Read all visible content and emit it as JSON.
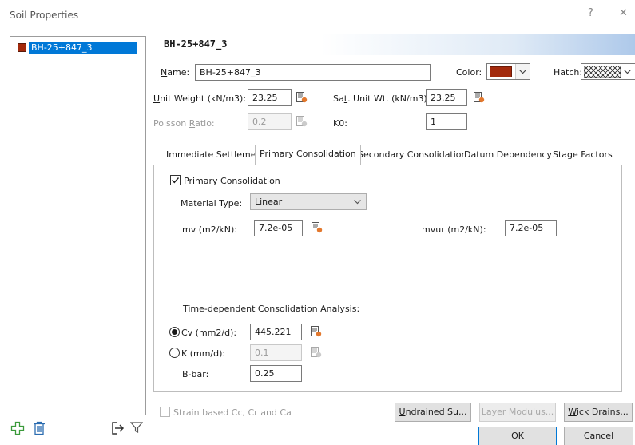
{
  "window": {
    "title": "Soil Properties",
    "help_glyph": "?",
    "close_glyph": "✕"
  },
  "materials": [
    {
      "name": "BH-25+847_3",
      "color": "#a32a0c"
    }
  ],
  "header": {
    "title": "BH-25+847_3"
  },
  "properties": {
    "name_label_accel": "N",
    "name_label_rest": "ame:",
    "name_value": "BH-25+847_3",
    "color_label": "Color:",
    "color_value": "#a32a0c",
    "hatch_label": "Hatch:",
    "unit_weight_accel": "U",
    "unit_weight_rest": "nit Weight (kN/m3):",
    "unit_weight_value": "23.25",
    "sat_unit_weight_pre": "Sa",
    "sat_unit_weight_accel": "t",
    "sat_unit_weight_rest": ". Unit Wt. (kN/m3)",
    "sat_unit_weight_value": "23.25",
    "poisson_pre": "Poisson ",
    "poisson_accel": "R",
    "poisson_rest": "atio:",
    "poisson_value": "0.2",
    "k0_label": "K0:",
    "k0_value": "1"
  },
  "tabs": [
    {
      "label": "Immediate Settlement",
      "active": false
    },
    {
      "label": "Primary Consolidation",
      "active": true
    },
    {
      "label": "Secondary Consolidation",
      "active": false
    },
    {
      "label": "Datum Dependency",
      "active": false
    },
    {
      "label": "Stage Factors",
      "active": false
    }
  ],
  "primary": {
    "enable_accel": "P",
    "enable_rest": "rimary Consolidation",
    "enable_checked": true,
    "material_type_label": "Material Type:",
    "material_type_value": "Linear",
    "mv_label": "mv (m2/kN):",
    "mv_value": "7.2e-05",
    "mvur_label": "mvur (m2/kN):",
    "mvur_value": "7.2e-05",
    "time_dep_label": "Time-dependent Consolidation Analysis:",
    "cv_label": "Cv (mm2/d):",
    "cv_value": "445.221",
    "cv_selected": true,
    "k_label": "K (mm/d):",
    "k_value": "0.1",
    "bbar_label": "B-bar:",
    "bbar_value": "0.25"
  },
  "footer": {
    "strain_label": "Strain based Cc, Cr and Ca",
    "undrained_accel": "U",
    "undrained_rest": "ndrained Su...",
    "layer_modulus": "Layer Modulus...",
    "wick_accel": "W",
    "wick_rest": "ick Drains...",
    "ok": "OK",
    "cancel": "Cancel"
  },
  "colors": {
    "accent": "#0078d7",
    "material": "#a32a0c",
    "add_icon": "#3a9a3a",
    "delete_icon": "#2b6cb0"
  }
}
